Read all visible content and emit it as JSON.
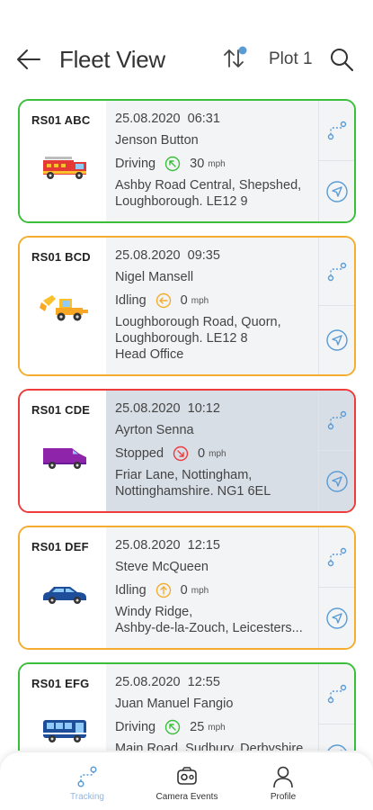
{
  "header": {
    "title": "Fleet View",
    "plot_label": "Plot 1"
  },
  "colors": {
    "driving": "#3bbf3b",
    "idling": "#f4ad2e",
    "stopped": "#ee3b3b",
    "accent": "#5b9bd5"
  },
  "vehicles": [
    {
      "plate": "RS01 ABC",
      "datetime": "25.08.2020  06:31",
      "driver": "Jenson Button",
      "status": "Driving",
      "speed": "30",
      "unit": "mph",
      "address": [
        "Ashby Road Central, Shepshed,",
        "Loughborough. LE12 9"
      ],
      "vehicle_icon": "fire-engine-icon"
    },
    {
      "plate": "RS01 BCD",
      "datetime": "25.08.2020  09:35",
      "driver": "Nigel Mansell",
      "status": "Idling",
      "speed": "0",
      "unit": "mph",
      "address": [
        "Loughborough Road, Quorn,",
        "Loughborough. LE12 8",
        "Head Office"
      ],
      "vehicle_icon": "digger-icon"
    },
    {
      "plate": "RS01 CDE",
      "datetime": "25.08.2020  10:12",
      "driver": "Ayrton Senna",
      "status": "Stopped",
      "speed": "0",
      "unit": "mph",
      "address": [
        "Friar Lane, Nottingham,",
        "Nottinghamshire. NG1 6EL"
      ],
      "vehicle_icon": "van-icon"
    },
    {
      "plate": "RS01 DEF",
      "datetime": "25.08.2020  12:15",
      "driver": "Steve McQueen",
      "status": "Idling",
      "speed": "0",
      "unit": "mph",
      "address": [
        "Windy Ridge,",
        "Ashby-de-la-Zouch, Leicesters..."
      ],
      "vehicle_icon": "car-icon"
    },
    {
      "plate": "RS01 EFG",
      "datetime": "25.08.2020  12:55",
      "driver": "Juan Manuel Fangio",
      "status": "Driving",
      "speed": "25",
      "unit": "mph",
      "address": [
        "Main Road, Sudbury, Derbyshire."
      ],
      "vehicle_icon": "bus-icon"
    }
  ],
  "tabs": [
    {
      "label": "Tracking",
      "icon": "tracking-icon"
    },
    {
      "label": "Camera Events",
      "icon": "camera-icon"
    },
    {
      "label": "Profile",
      "icon": "profile-icon"
    }
  ]
}
